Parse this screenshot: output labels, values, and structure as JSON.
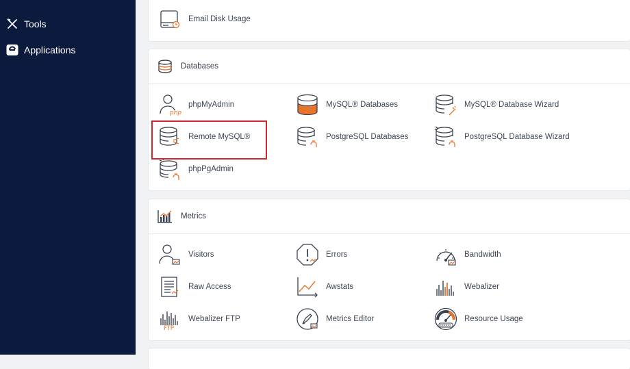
{
  "sidebar": {
    "items": [
      {
        "label": "Tools",
        "icon": "tools-icon"
      },
      {
        "label": "Applications",
        "icon": "applications-icon"
      }
    ]
  },
  "files_panel": {
    "items": [
      {
        "label": "Email Disk Usage",
        "icon": "email-disk-usage-icon"
      }
    ]
  },
  "databases_panel": {
    "title": "Databases",
    "items": [
      {
        "label": "phpMyAdmin",
        "icon": "phpmyadmin-icon",
        "sub": "php"
      },
      {
        "label": "MySQL® Databases",
        "icon": "mysql-databases-icon"
      },
      {
        "label": "MySQL® Database Wizard",
        "icon": "mysql-database-wizard-icon"
      },
      {
        "label": "Remote MySQL®",
        "icon": "remote-mysql-icon"
      },
      {
        "label": "PostgreSQL Databases",
        "icon": "postgresql-databases-icon"
      },
      {
        "label": "PostgreSQL Database Wizard",
        "icon": "postgresql-database-wizard-icon"
      },
      {
        "label": "phpPgAdmin",
        "icon": "phppgadmin-icon"
      }
    ]
  },
  "metrics_panel": {
    "title": "Metrics",
    "items": [
      {
        "label": "Visitors",
        "icon": "visitors-icon"
      },
      {
        "label": "Errors",
        "icon": "errors-icon"
      },
      {
        "label": "Bandwidth",
        "icon": "bandwidth-icon"
      },
      {
        "label": "Raw Access",
        "icon": "raw-access-icon"
      },
      {
        "label": "Awstats",
        "icon": "awstats-icon"
      },
      {
        "label": "Webalizer",
        "icon": "webalizer-icon"
      },
      {
        "label": "Webalizer FTP",
        "icon": "webalizer-ftp-icon",
        "sub": "FTP"
      },
      {
        "label": "Metrics Editor",
        "icon": "metrics-editor-icon"
      },
      {
        "label": "Resource Usage",
        "icon": "resource-usage-icon",
        "sub": "00000"
      }
    ]
  },
  "colors": {
    "sidebar_bg": "#0c1a3d",
    "accent_orange": "#e8742c",
    "highlight_red": "#d3262c",
    "icon_stroke": "#3a4250"
  }
}
